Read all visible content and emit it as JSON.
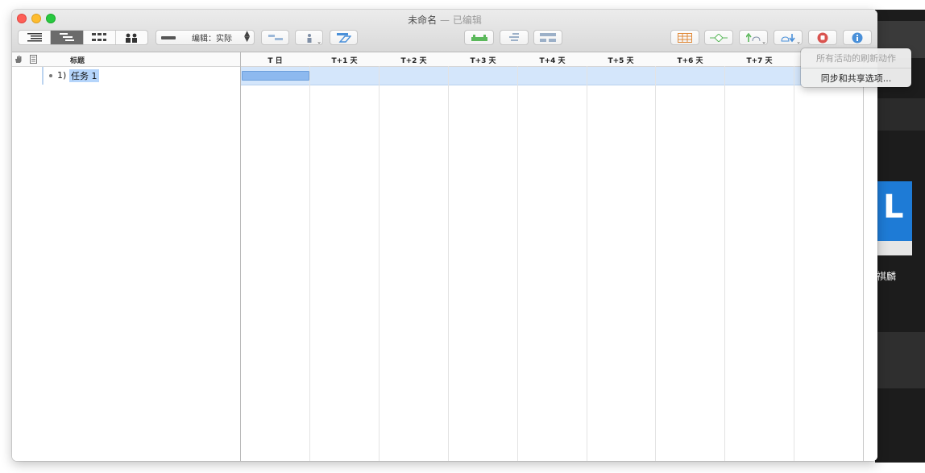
{
  "window": {
    "title": "未命名",
    "title_separator": " — ",
    "subtitle": "已编辑"
  },
  "toolbar": {
    "view_mode_buttons": [
      "outline-view-icon",
      "gantt-view-icon",
      "network-view-icon",
      "resource-view-icon"
    ],
    "active_view_index": 1,
    "view_select_label": "编辑：实际",
    "colors": {
      "accent": "#4a90d9",
      "green": "#5bb85b",
      "orange": "#e08a3a",
      "red": "#d9534f"
    }
  },
  "outline": {
    "header_title": "标题",
    "rows": [
      {
        "number": "1)",
        "name": "任务 1"
      }
    ]
  },
  "timeline": {
    "day_headers": [
      "T 日",
      "T+1 天",
      "T+2 天",
      "T+3 天",
      "T+4 天",
      "T+5 天",
      "T+6 天",
      "T+7 天"
    ]
  },
  "menu": {
    "items": [
      {
        "label": "所有活动的刷新动作",
        "enabled": false
      },
      {
        "label": "同步和共享选项...",
        "enabled": true
      }
    ]
  },
  "desktop": {
    "caption": "祺麟"
  }
}
